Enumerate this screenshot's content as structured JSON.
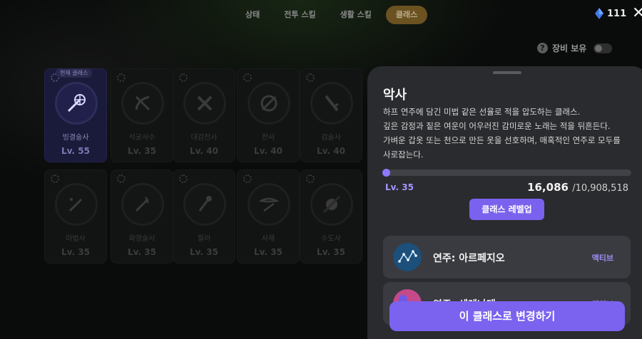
{
  "tabs": [
    {
      "label": "상태"
    },
    {
      "label": "전투 스킬"
    },
    {
      "label": "생활 스킬"
    },
    {
      "label": "클래스"
    }
  ],
  "currency": {
    "amount": "111",
    "icon": "blue-gem-icon"
  },
  "equip_toggle": {
    "label": "장비 보유",
    "on": false
  },
  "classes": [
    {
      "name": "빙결술사",
      "level": "Lv. 55",
      "current": true,
      "icon": "crossed-sword-snowflake-icon"
    },
    {
      "name": "석궁사수",
      "level": "Lv. 35",
      "icon": "crossbow-icon"
    },
    {
      "name": "대검전사",
      "level": "Lv. 40",
      "icon": "greatsword-icon"
    },
    {
      "name": "전사",
      "level": "Lv. 40",
      "icon": "shield-icon"
    },
    {
      "name": "검술사",
      "level": "Lv. 40",
      "icon": "sword-icon"
    },
    {
      "name": "마법사",
      "level": "Lv. 35",
      "icon": "wand-icon"
    },
    {
      "name": "화염술사",
      "level": "Lv. 35",
      "icon": "flame-staff-icon"
    },
    {
      "name": "힐러",
      "level": "Lv. 35",
      "icon": "healing-staff-icon"
    },
    {
      "name": "사제",
      "level": "Lv. 35",
      "icon": "winged-icon"
    },
    {
      "name": "수도사",
      "level": "Lv. 35",
      "icon": "fist-staff-icon"
    }
  ],
  "current_badge": "현재 클래스",
  "detail": {
    "title": "악사",
    "description": [
      "하프 연주에 담긴 미법 같은 선율로 적을 압도하는 클래스.",
      "깊은 감정과 짙은 여운이 어우러진 감미로운 노래는 적을 뒤흔든다.",
      "가벼운 갑옷 또는 천으로 만든 옷을 선호하며, 매혹적인 연주로 모두를",
      "사로잡는다."
    ],
    "level": "Lv. 35",
    "xp_current": "16,086",
    "xp_max": "/10,908,518",
    "xp_fraction": 0.0015,
    "level_up_label": "클래스 레벨업",
    "skills": [
      {
        "name": "연주: 아르페지오",
        "tag": "액티브",
        "icon": "constellation-icon"
      },
      {
        "name": "연주: 세레나데",
        "tag": "액티브",
        "icon": "star-orb-icon"
      }
    ],
    "change_label": "이 클래스로 변경하기"
  },
  "colors": {
    "accent": "#7b63f0",
    "accent_text": "#a496ff",
    "panel": "#2a2b2e"
  }
}
